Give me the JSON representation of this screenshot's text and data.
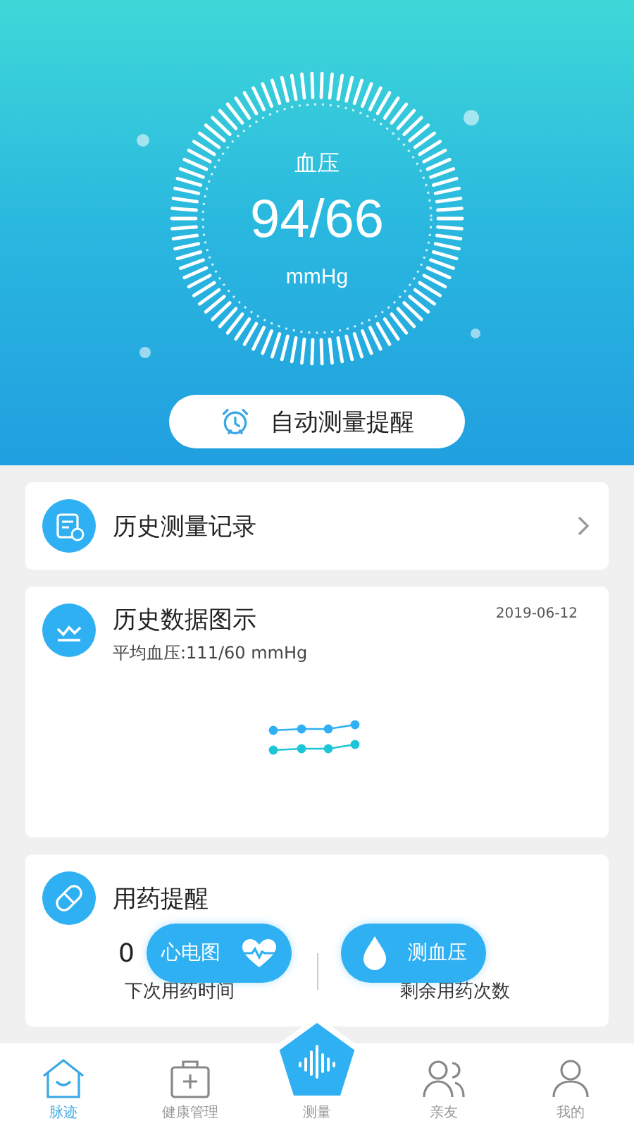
{
  "gauge": {
    "label": "血压",
    "reading": "94/66",
    "unit": "mmHg"
  },
  "reminder_button": {
    "label": "自动测量提醒"
  },
  "history_records": {
    "title": "历史测量记录"
  },
  "history_chart": {
    "title": "历史数据图示",
    "subtitle": "平均血压:111/60 mmHg",
    "date": "2019-06-12"
  },
  "medication": {
    "title": "用药提醒",
    "next_value": "0",
    "next_label": "下次用药时间",
    "remaining_label": "剩余用药次数"
  },
  "float_buttons": [
    {
      "label": "心电图",
      "kind": "heart"
    },
    {
      "label": "测血压",
      "kind": "drop"
    }
  ],
  "tabs": [
    {
      "label": "脉迹",
      "kind": "home",
      "selected": true
    },
    {
      "label": "健康管理",
      "kind": "kit",
      "selected": false
    },
    {
      "label": "测量",
      "kind": "measure",
      "selected": false
    },
    {
      "label": "亲友",
      "kind": "friends",
      "selected": false
    },
    {
      "label": "我的",
      "kind": "person",
      "selected": false
    }
  ]
}
